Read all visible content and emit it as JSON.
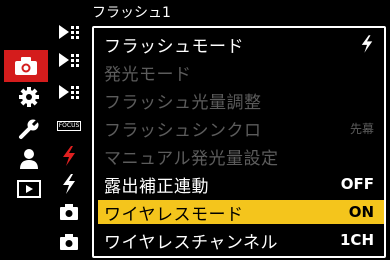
{
  "header": {
    "title": "フラッシュ1"
  },
  "tabs": [
    {
      "icon": "camera-icon",
      "active": true
    },
    {
      "icon": "gear-icon"
    },
    {
      "icon": "wrench-icon"
    },
    {
      "icon": "person-icon"
    },
    {
      "icon": "playback-icon"
    }
  ],
  "subtabs": [
    {
      "icon": "flash-grid-icon"
    },
    {
      "icon": "flash-grid-icon"
    },
    {
      "icon": "flash-grid-icon"
    },
    {
      "icon": "focus-icon",
      "text": "FOCUS"
    },
    {
      "icon": "flash-icon",
      "active": true
    },
    {
      "icon": "flash-icon"
    },
    {
      "icon": "camera-settings-icon"
    },
    {
      "icon": "camera-settings-icon"
    }
  ],
  "menu": {
    "items": [
      {
        "label": "フラッシュモード",
        "value": "",
        "value_icon": "flash-icon",
        "disabled": false,
        "selected": false
      },
      {
        "label": "発光モード",
        "value": "",
        "disabled": true,
        "selected": false
      },
      {
        "label": "フラッシュ光量調整",
        "value": "",
        "disabled": true,
        "selected": false
      },
      {
        "label": "フラッシュシンクロ",
        "value": "先幕",
        "disabled": true,
        "selected": false
      },
      {
        "label": "マニュアル発光量設定",
        "value": "",
        "disabled": true,
        "selected": false
      },
      {
        "label": "露出補正連動",
        "value": "OFF",
        "disabled": false,
        "selected": false
      },
      {
        "label": "ワイヤレスモード",
        "value": "ON",
        "disabled": false,
        "selected": true
      },
      {
        "label": "ワイヤレスチャンネル",
        "value": "1CH",
        "disabled": false,
        "selected": false
      }
    ]
  },
  "colors": {
    "accent_tab": "#d41c1c",
    "selection": "#f4c51c",
    "disabled_text": "#5c5c5c"
  }
}
